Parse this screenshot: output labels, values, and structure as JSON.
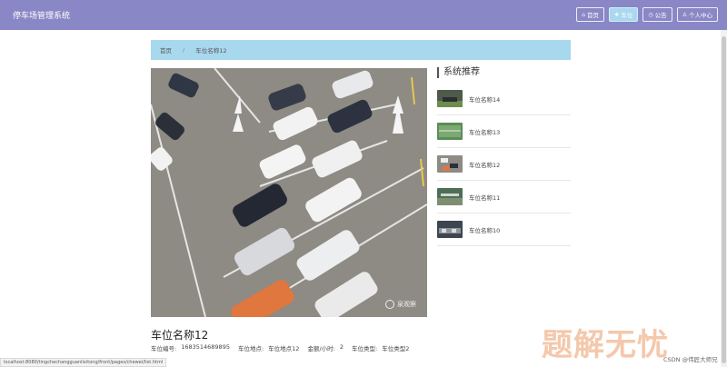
{
  "app": {
    "title": "停车场管理系统"
  },
  "nav": [
    {
      "label": "首页",
      "icon": "home-icon",
      "active": false
    },
    {
      "label": "车位",
      "icon": "parking-icon",
      "active": true
    },
    {
      "label": "公告",
      "icon": "notice-icon",
      "active": false
    },
    {
      "label": "个人中心",
      "icon": "user-icon",
      "active": false
    }
  ],
  "breadcrumb": {
    "home": "首页",
    "separator": "/",
    "current": "车位名称12"
  },
  "photo": {
    "watermark": "泉观察"
  },
  "sidebar": {
    "title": "系统推荐",
    "items": [
      {
        "label": "车位名称14"
      },
      {
        "label": "车位名称13"
      },
      {
        "label": "车位名称12"
      },
      {
        "label": "车位名称11"
      },
      {
        "label": "车位名称10"
      }
    ]
  },
  "detail": {
    "title": "车位名称12",
    "fields": [
      {
        "label": "车位编号:",
        "value": "1683514689895"
      },
      {
        "label": "车位地点:",
        "value": "车位地点12"
      },
      {
        "label": "金额/小时:",
        "value": "2"
      },
      {
        "label": "车位类型:",
        "value": "车位类型2"
      }
    ]
  },
  "statusbar": {
    "url": "localhost:8080/tingchechangguanlixitong/front/pages/chewei/list.html"
  },
  "watermark": {
    "brand": "题解无忧",
    "csdn": "CSDN @伟匠大师兄"
  },
  "colors": {
    "topbar": "#8a87c6",
    "breadcrumb": "#a8d8ee",
    "active_nav": "#a9d8f0",
    "brand_watermark": "#f4c6a8"
  }
}
